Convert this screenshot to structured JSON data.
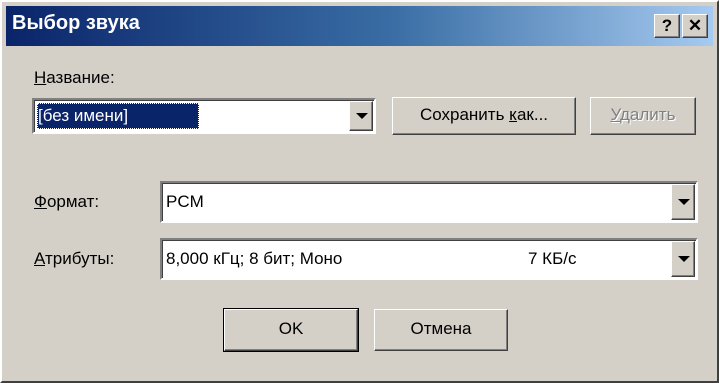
{
  "window": {
    "title": "Выбор звука",
    "help_label": "?",
    "close_label": "✕"
  },
  "name_field": {
    "label_hotkey": "Н",
    "label_rest": "азвание:",
    "value": "[без имени]"
  },
  "buttons": {
    "save_as_pre": "Сохранить ",
    "save_as_hotkey": "к",
    "save_as_post": "ак...",
    "delete_hotkey": "У",
    "delete_rest": "далить",
    "ok": "OK",
    "cancel": "Отмена"
  },
  "format_field": {
    "label_hotkey": "Ф",
    "label_rest": "ормат:",
    "value": "PCM"
  },
  "attributes_field": {
    "label_hotkey": "А",
    "label_rest": "трибуты:",
    "value": "8,000 кГц; 8 бит; Моно",
    "rate": "7 КБ/с"
  },
  "icons": {
    "help": "help-icon",
    "close": "close-icon",
    "dropdown": "chevron-down-icon"
  },
  "colors": {
    "titlebar_start": "#0a246a",
    "titlebar_end": "#a6caf0",
    "dialog_face": "#d4d0c8",
    "selection": "#0a246a"
  }
}
